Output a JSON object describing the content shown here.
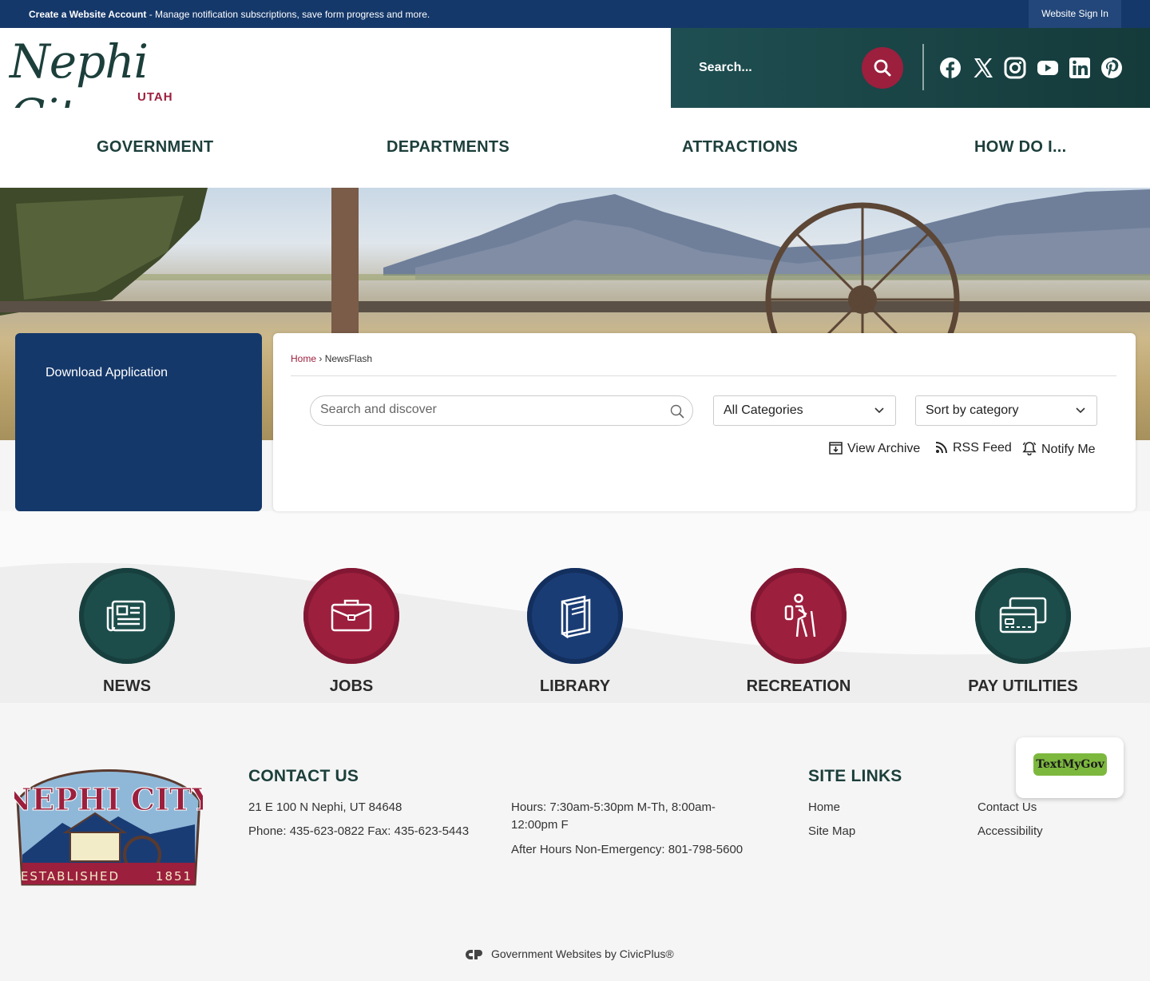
{
  "topbar": {
    "create_account": "Create a Website Account",
    "message": " - Manage notification subscriptions, save form progress and more.",
    "sign_in": "Website Sign In"
  },
  "header": {
    "logo_script": "Nephi City",
    "logo_sub": "UTAH",
    "search_placeholder": "Search...",
    "social": [
      "facebook-icon",
      "x-icon",
      "instagram-icon",
      "youtube-icon",
      "linkedin-icon",
      "pinterest-icon"
    ]
  },
  "nav": {
    "items": [
      "GOVERNMENT",
      "DEPARTMENTS",
      "ATTRACTIONS",
      "HOW DO I..."
    ]
  },
  "sidebar": {
    "link": "Download Application"
  },
  "newsflash": {
    "breadcrumb_home": "Home",
    "breadcrumb_sep": " › ",
    "breadcrumb_current": "NewsFlash",
    "search_placeholder": "Search and discover",
    "category_select": "All Categories",
    "sort_select": "Sort by category",
    "actions": {
      "archive": "View Archive",
      "rss": "RSS Feed",
      "notify": "Notify Me"
    }
  },
  "quicklinks": [
    {
      "label": "NEWS",
      "icon": "newspaper-icon",
      "color": "teal"
    },
    {
      "label": "JOBS",
      "icon": "briefcase-icon",
      "color": "red"
    },
    {
      "label": "LIBRARY",
      "icon": "book-icon",
      "color": "blue"
    },
    {
      "label": "RECREATION",
      "icon": "hiker-icon",
      "color": "red"
    },
    {
      "label": "PAY UTILITIES",
      "icon": "credit-cards-icon",
      "color": "teal"
    }
  ],
  "footer": {
    "seal_text_top": "NEPHI CITY",
    "seal_text_bottom": "ESTABLISHED",
    "seal_year": "1851",
    "contact_heading": "CONTACT US",
    "address": "21 E 100 N Nephi, UT 84648",
    "phone": "Phone: 435-623-0822 Fax: 435-623-5443",
    "hours": "Hours: 7:30am-5:30pm M-Th, 8:00am-12:00pm F",
    "after_hours": "After Hours Non-Emergency: 801-798-5600",
    "sitelinks_heading": "SITE LINKS",
    "sitelinks": [
      "Home",
      "Contact Us",
      "Site Map",
      "Accessibility"
    ],
    "textmygov": "TextMyGov",
    "civicplus": "Government Websites by CivicPlus®"
  },
  "colors": {
    "navy": "#15386a",
    "teal": "#1c4d4b",
    "maroon": "#9c1f3d"
  }
}
